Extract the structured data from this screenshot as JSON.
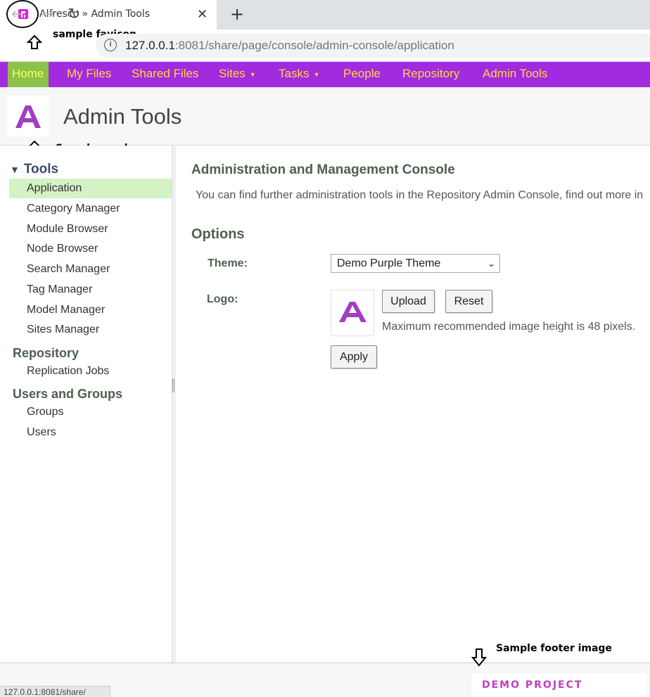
{
  "browser": {
    "tab_title": "Alfresco » Admin Tools",
    "url_host": "127.0.0.1",
    "url_rest": ":8081/share/page/console/admin-console/application",
    "favicon_letter": "R",
    "status_url": "127.0.0.1:8081/share/"
  },
  "annotations": {
    "favicon": "sample favicon",
    "app_logo": "Sample app logo",
    "footer": "Sample footer image"
  },
  "nav": {
    "home": "Home",
    "my_files": "My Files",
    "shared_files": "Shared Files",
    "sites": "Sites",
    "tasks": "Tasks",
    "people": "People",
    "repository": "Repository",
    "admin_tools": "Admin Tools"
  },
  "header": {
    "title": "Admin Tools"
  },
  "sidebar": {
    "tools_heading": "Tools",
    "tools_items": [
      "Application",
      "Category Manager",
      "Module Browser",
      "Node Browser",
      "Search Manager",
      "Tag Manager",
      "Model Manager",
      "Sites Manager"
    ],
    "repository_heading": "Repository",
    "repository_items": [
      "Replication Jobs"
    ],
    "users_heading": "Users and Groups",
    "users_items": [
      "Groups",
      "Users"
    ]
  },
  "main": {
    "title": "Administration and Management Console",
    "description": "You can find further administration tools in the Repository Admin Console, find out more in",
    "options_title": "Options",
    "theme_label": "Theme:",
    "theme_value": "Demo Purple Theme",
    "logo_label": "Logo:",
    "upload_label": "Upload",
    "reset_label": "Reset",
    "hint": "Maximum recommended image height is 48 pixels.",
    "apply_label": "Apply"
  },
  "footer": {
    "image_text": "DEMO PROJECT"
  },
  "colors": {
    "nav_bg": "#a22be0",
    "nav_text": "#ffd83a",
    "home_bg": "#8bc34a",
    "selected_bg": "#d4f2c4",
    "logo_purple": "#a040c0"
  }
}
